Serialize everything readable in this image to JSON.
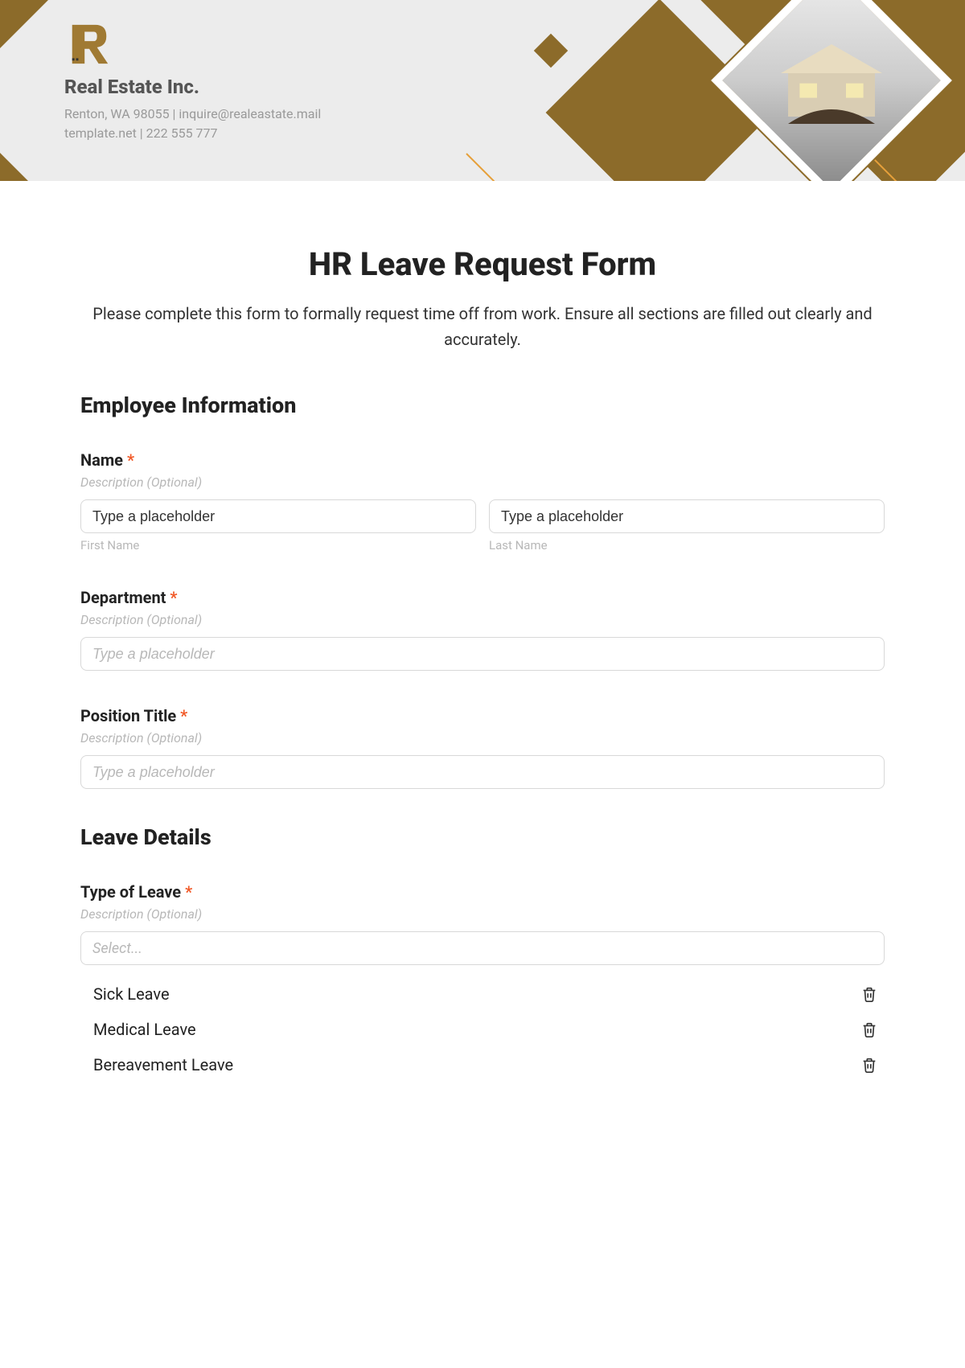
{
  "header": {
    "company_name": "Real Estate Inc.",
    "line1": "Renton, WA 98055 | inquire@realeastate.mail",
    "line2": "template.net | 222 555 777"
  },
  "form": {
    "title": "HR Leave Request Form",
    "description": "Please complete this form to formally request time off from work. Ensure all sections are filled out clearly and accurately.",
    "sections": {
      "employee": {
        "heading": "Employee Information",
        "name": {
          "label": "Name",
          "desc": "Description (Optional)",
          "first_value": "Type a placeholder",
          "last_value": "Type a placeholder",
          "first_sub": "First Name",
          "last_sub": "Last Name"
        },
        "department": {
          "label": "Department",
          "desc": "Description (Optional)",
          "placeholder": "Type a placeholder"
        },
        "position": {
          "label": "Position Title",
          "desc": "Description (Optional)",
          "placeholder": "Type a placeholder"
        }
      },
      "leave": {
        "heading": "Leave Details",
        "type": {
          "label": "Type of Leave",
          "desc": "Description (Optional)",
          "placeholder": "Select...",
          "options": [
            "Sick Leave",
            "Medical Leave",
            "Bereavement Leave"
          ]
        }
      }
    },
    "required_mark": "*"
  }
}
